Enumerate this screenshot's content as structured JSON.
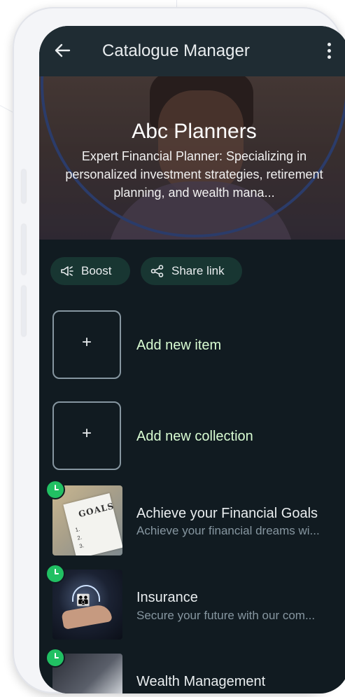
{
  "header": {
    "title": "Catalogue Manager",
    "back_icon": "arrow-left-icon",
    "menu_icon": "more-vert-icon"
  },
  "profile": {
    "name": "Abc Planners",
    "description": "Expert Financial Planner: Specializing in personalized investment strategies, retirement planning, and wealth mana..."
  },
  "actions": {
    "boost_label": "Boost",
    "share_label": "Share link"
  },
  "add": {
    "item_label": "Add new item",
    "collection_label": "Add new collection",
    "plus": "+"
  },
  "items": [
    {
      "title": "Achieve your Financial Goals",
      "description": "Achieve your financial dreams wi...",
      "thumb_text": "GOALS"
    },
    {
      "title": "Insurance",
      "description": "Secure your future with our com..."
    },
    {
      "title": "Wealth Management",
      "description": ""
    }
  ],
  "colors": {
    "background": "#111b21",
    "appbar": "#1f2c33",
    "accent_green": "#21c063",
    "chip_bg": "#183632",
    "link_text": "#d9fdd3"
  }
}
